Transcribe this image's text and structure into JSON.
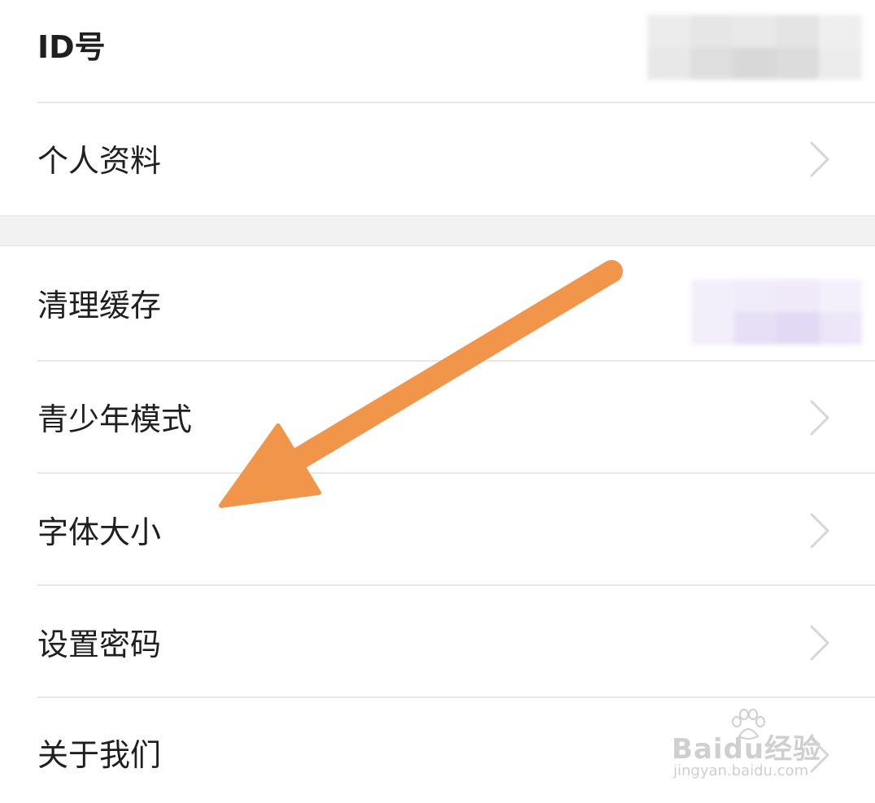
{
  "settings": {
    "id_row": {
      "label": "ID号"
    },
    "items": [
      {
        "label": "个人资料"
      },
      {
        "label": "清理缓存"
      },
      {
        "label": "青少年模式"
      },
      {
        "label": "字体大小"
      },
      {
        "label": "设置密码"
      },
      {
        "label": "关于我们"
      }
    ]
  },
  "watermark": {
    "brand": "Baidu经验",
    "url": "jingyan.baidu.com"
  },
  "colors": {
    "arrow": "#F0954A",
    "divider": "#E8E8E8",
    "section_gap": "#F2F2F2",
    "chevron": "#D6D6D6"
  },
  "icons": {
    "row_chevron": "chevron-right-icon",
    "annotation": "arrow-annotation"
  }
}
